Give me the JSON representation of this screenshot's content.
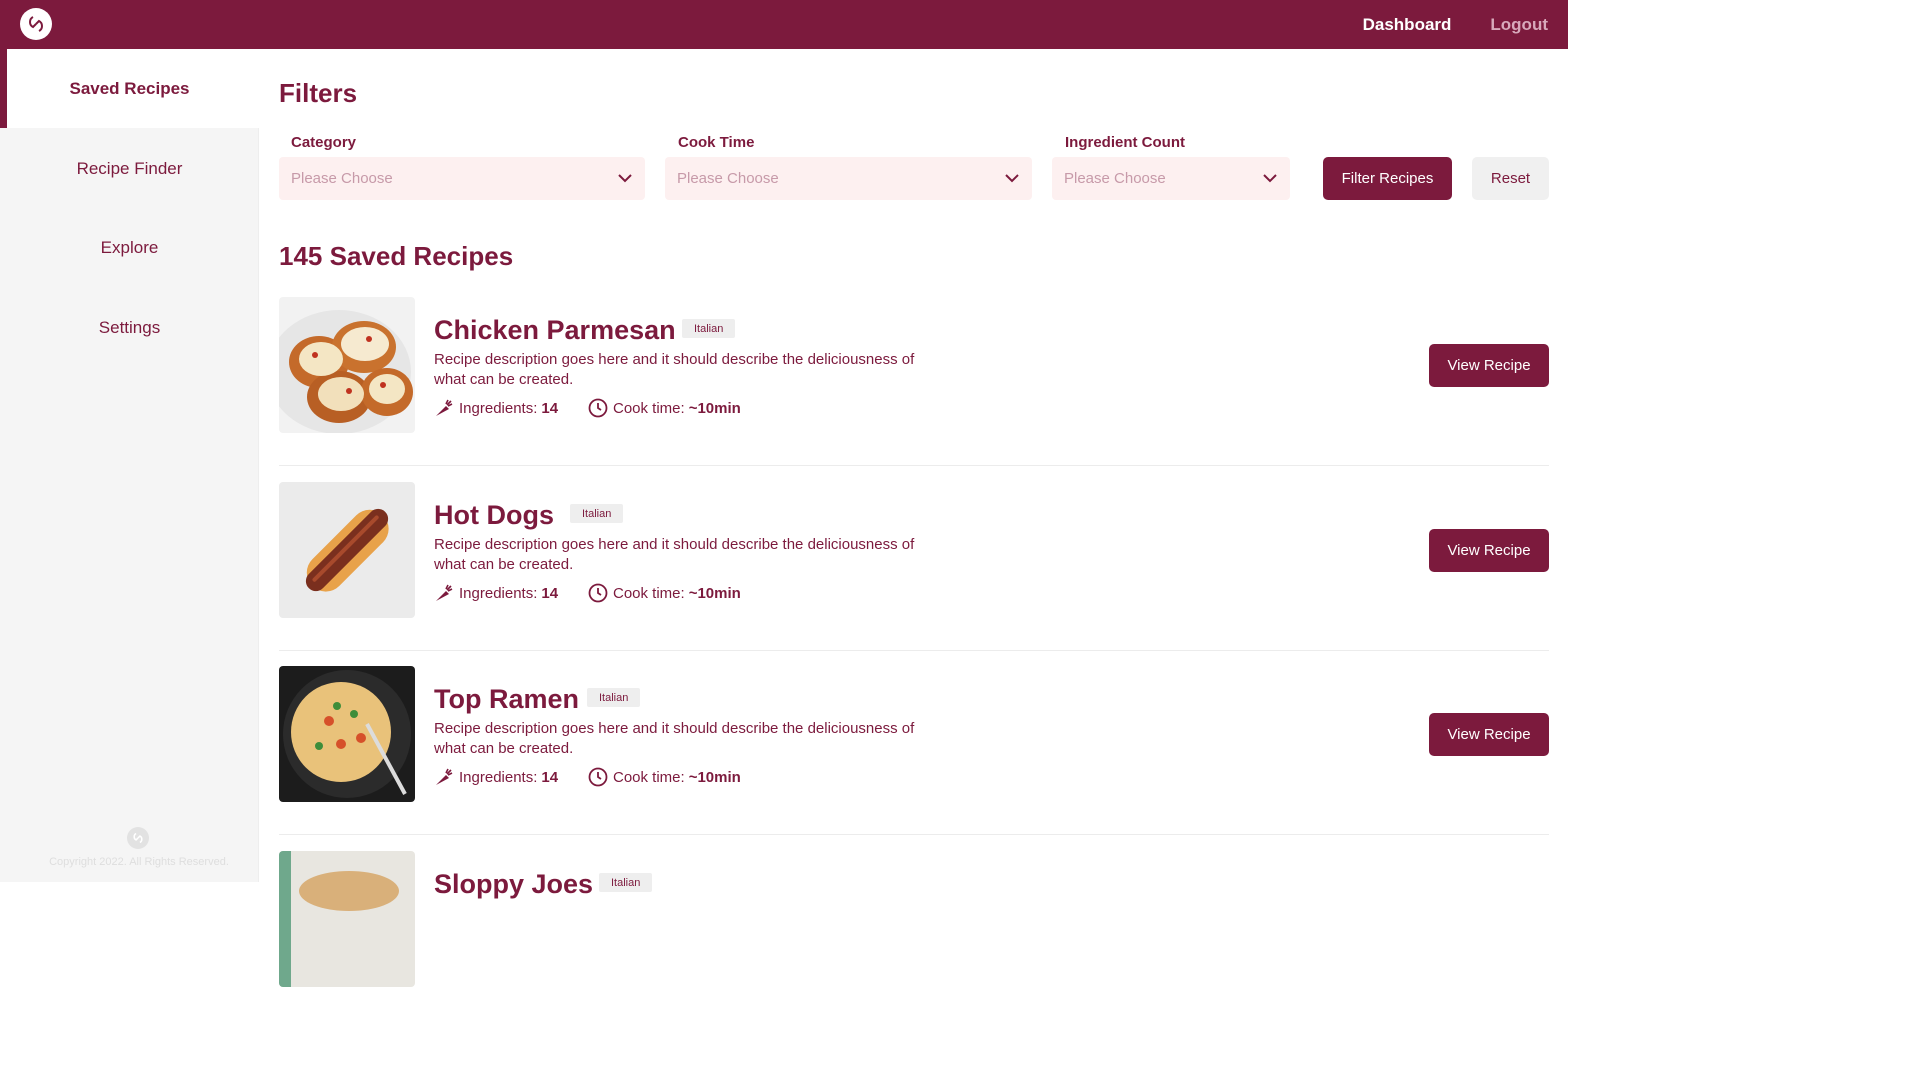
{
  "nav": {
    "dashboard": "Dashboard",
    "logout": "Logout"
  },
  "sidebar": {
    "items": [
      {
        "label": "Saved Recipes"
      },
      {
        "label": "Recipe Finder"
      },
      {
        "label": "Explore"
      },
      {
        "label": "Settings"
      }
    ],
    "copyright": "Copyright 2022. All Rights Reserved."
  },
  "filters": {
    "title": "Filters",
    "category": {
      "label": "Category",
      "placeholder": "Please Choose"
    },
    "cook_time": {
      "label": "Cook Time",
      "placeholder": "Please Choose"
    },
    "ingredient_count": {
      "label": "Ingredient Count",
      "placeholder": "Please Choose"
    },
    "filter_button": "Filter Recipes",
    "reset_button": "Reset"
  },
  "saved_title": "145 Saved Recipes",
  "recipes": [
    {
      "title": "Chicken Parmesan",
      "tag": "Italian",
      "description": "Recipe description goes here and it should describe the deliciousness of what can be created.",
      "ingredients_label": "Ingredients:",
      "ingredients": "14",
      "cook_label": "Cook time:",
      "cook_time": "~10min",
      "button": "View Recipe"
    },
    {
      "title": "Hot Dogs",
      "tag": "Italian",
      "description": "Recipe description goes here and it should describe the deliciousness of what can be created.",
      "ingredients_label": "Ingredients:",
      "ingredients": "14",
      "cook_label": "Cook time:",
      "cook_time": "~10min",
      "button": "View Recipe"
    },
    {
      "title": "Top Ramen",
      "tag": "Italian",
      "description": "Recipe description goes here and it should describe the deliciousness of what can be created.",
      "ingredients_label": "Ingredients:",
      "ingredients": "14",
      "cook_label": "Cook time:",
      "cook_time": "~10min",
      "button": "View Recipe"
    },
    {
      "title": "Sloppy Joes",
      "tag": "Italian"
    }
  ],
  "colors": {
    "brand": "#7c1a3d",
    "select_bg": "#fdf0f0",
    "sidebar_bg": "#f5f5f5"
  }
}
